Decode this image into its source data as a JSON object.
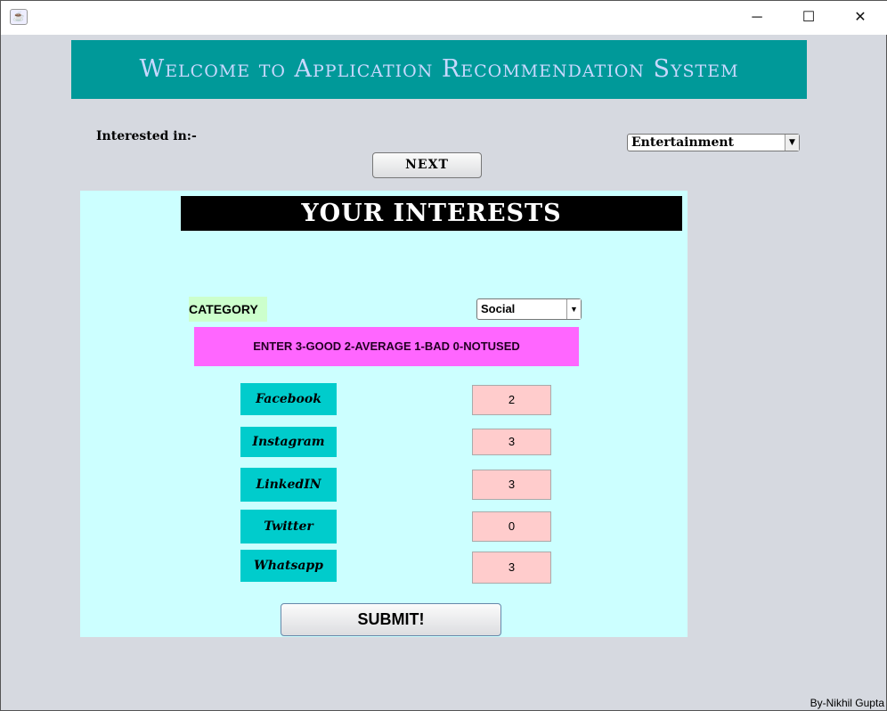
{
  "window": {
    "app_icon": "java-icon",
    "minimize": "─",
    "maximize": "☐",
    "close": "✕"
  },
  "banner": "Welcome to Application Recommendation System",
  "interested_label": "Interested in:-",
  "interest_select": {
    "value": "Entertainment"
  },
  "next_label": "NEXT",
  "panel": {
    "header": "YOUR INTERESTS",
    "category_label": "CATEGORY",
    "category_select": {
      "value": "Social"
    },
    "instructions": "ENTER 3-GOOD 2-AVERAGE 1-BAD 0-NOTUSED",
    "apps": [
      {
        "name": "Facebook",
        "rating": "2"
      },
      {
        "name": "Instagram",
        "rating": "3"
      },
      {
        "name": "LinkedIN",
        "rating": "3"
      },
      {
        "name": "Twitter",
        "rating": "0"
      },
      {
        "name": "Whatsapp",
        "rating": "3"
      }
    ],
    "submit_label": "SUBMIT!"
  },
  "credit": "By-Nikhil Gupta"
}
